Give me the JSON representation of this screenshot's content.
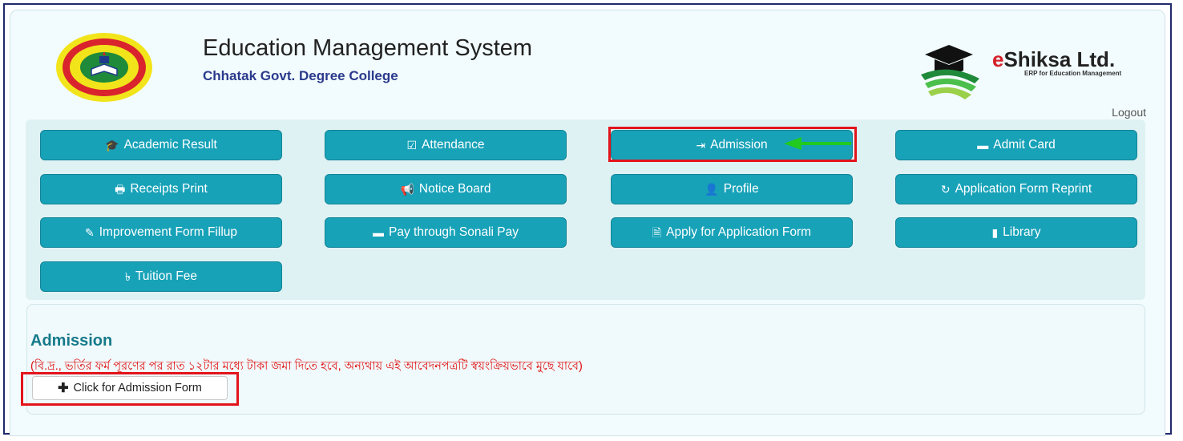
{
  "header": {
    "title": "Education Management System",
    "subtitle": "Chhatak Govt. Degree College",
    "brand_e": "e",
    "brand_rest": "Shiksa Ltd.",
    "brand_tagline": "ERP for Education Management",
    "logout_label": "Logout"
  },
  "menu": {
    "items": [
      {
        "label": "Academic Result",
        "icon": "graduation-cap-icon"
      },
      {
        "label": "Attendance",
        "icon": "check-square-icon"
      },
      {
        "label": "Admission",
        "icon": "sign-in-icon"
      },
      {
        "label": "Admit Card",
        "icon": "credit-card-icon"
      },
      {
        "label": "Receipts Print",
        "icon": "print-icon"
      },
      {
        "label": "Notice Board",
        "icon": "bullhorn-icon"
      },
      {
        "label": "Profile",
        "icon": "user-icon"
      },
      {
        "label": "Application Form Reprint",
        "icon": "refresh-icon"
      },
      {
        "label": "Improvement Form Fillup",
        "icon": "pencil-icon"
      },
      {
        "label": "Pay through Sonali Pay",
        "icon": "credit-card-icon"
      },
      {
        "label": "Apply for Application Form",
        "icon": "file-icon"
      },
      {
        "label": "Library",
        "icon": "book-icon"
      },
      {
        "label": "Tuition Fee",
        "icon": "taka-icon"
      }
    ]
  },
  "admission": {
    "heading": "Admission",
    "notice": "(বি.দ্র., ভর্তির ফর্ম পূরণের পর রাত ১২টার মধ্যে টাকা জমা দিতে হবে, অন্যথায় এই আবেদনপত্রটি স্বয়ংক্রিয়ভাবে মুছে যাবে)",
    "form_button_label": "Click for Admission Form"
  },
  "colors": {
    "button": "#17a2b8",
    "highlight": "#e3141c",
    "notice_text": "#e01010",
    "arrow": "#22c91e"
  }
}
